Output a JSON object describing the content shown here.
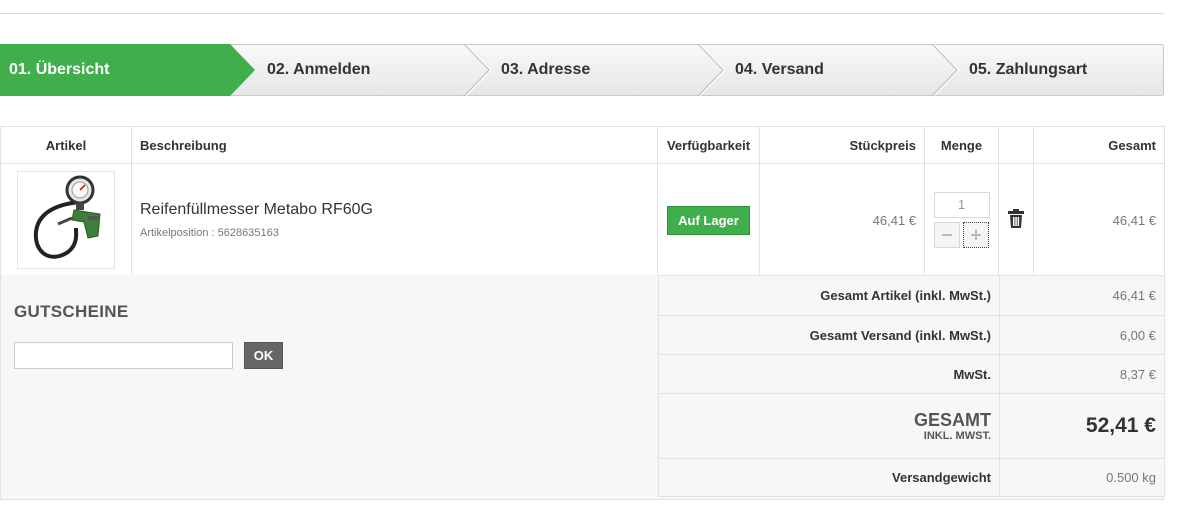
{
  "steps": [
    {
      "label": "01. Übersicht",
      "active": true
    },
    {
      "label": "02. Anmelden"
    },
    {
      "label": "03. Adresse"
    },
    {
      "label": "04. Versand"
    },
    {
      "label": "05. Zahlungsart"
    }
  ],
  "colors": {
    "accent": "#3fae4b",
    "button_dark": "#666666",
    "border": "#e2e2e2"
  },
  "cart": {
    "headers": {
      "artikel": "Artikel",
      "beschreibung": "Beschreibung",
      "verfuegbarkeit": "Verfügbarkeit",
      "stueckpreis": "Stückpreis",
      "menge": "Menge",
      "gesamt": "Gesamt"
    },
    "item": {
      "image_icon": "tire-inflator-gauge-image",
      "name": "Reifenfüllmesser Metabo RF60G",
      "position": "Artikelposition : 5628635163",
      "availability": "Auf Lager",
      "unit_price": "46,41 €",
      "quantity": "1",
      "total": "46,41 €",
      "delete_icon": "trash-icon"
    }
  },
  "coupon": {
    "title": "GUTSCHEINE",
    "input_value": "",
    "ok_label": "OK"
  },
  "totals": {
    "articles_label": "Gesamt Artikel (inkl. MwSt.)",
    "articles_value": "46,41 €",
    "shipping_label": "Gesamt Versand (inkl. MwSt.)",
    "shipping_value": "6,00 €",
    "vat_label": "MwSt.",
    "vat_value": "8,37 €",
    "grand_label": "GESAMT",
    "grand_sub": "INKL. MWST.",
    "grand_value": "52,41 €",
    "weight_label": "Versandgewicht",
    "weight_value": "0.500 kg"
  }
}
